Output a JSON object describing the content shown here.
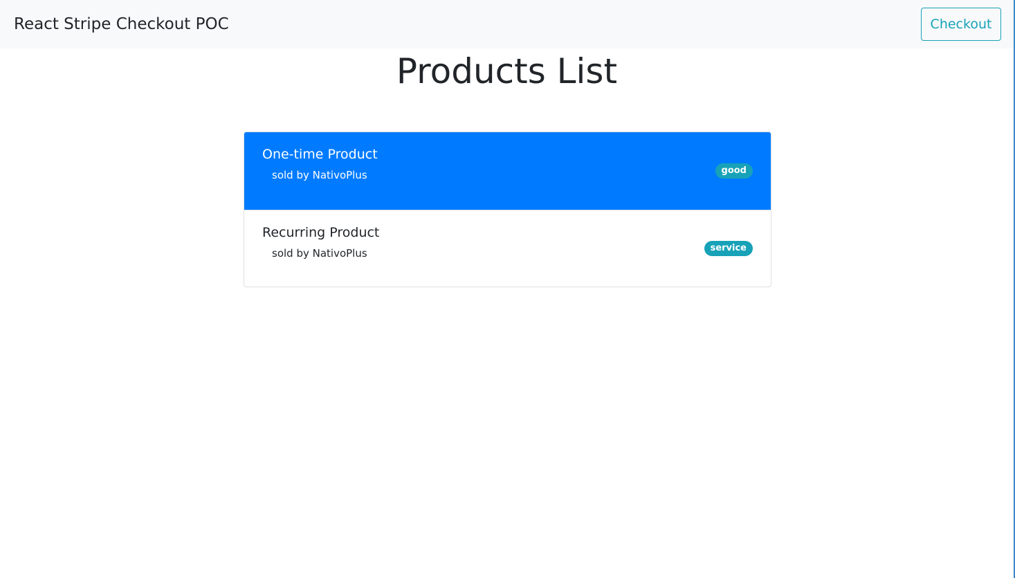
{
  "navbar": {
    "brand": "React Stripe Checkout POC",
    "checkout_label": "Checkout"
  },
  "page": {
    "title": "Products List"
  },
  "products": [
    {
      "title": "One-time Product",
      "seller": "sold by NativoPlus",
      "badge": "good",
      "active": true
    },
    {
      "title": "Recurring Product",
      "seller": "sold by NativoPlus",
      "badge": "service",
      "active": false
    }
  ],
  "colors": {
    "primary": "#007bff",
    "info": "#17a2b8",
    "navbar_bg": "#f8f9fa",
    "text": "#212529"
  }
}
